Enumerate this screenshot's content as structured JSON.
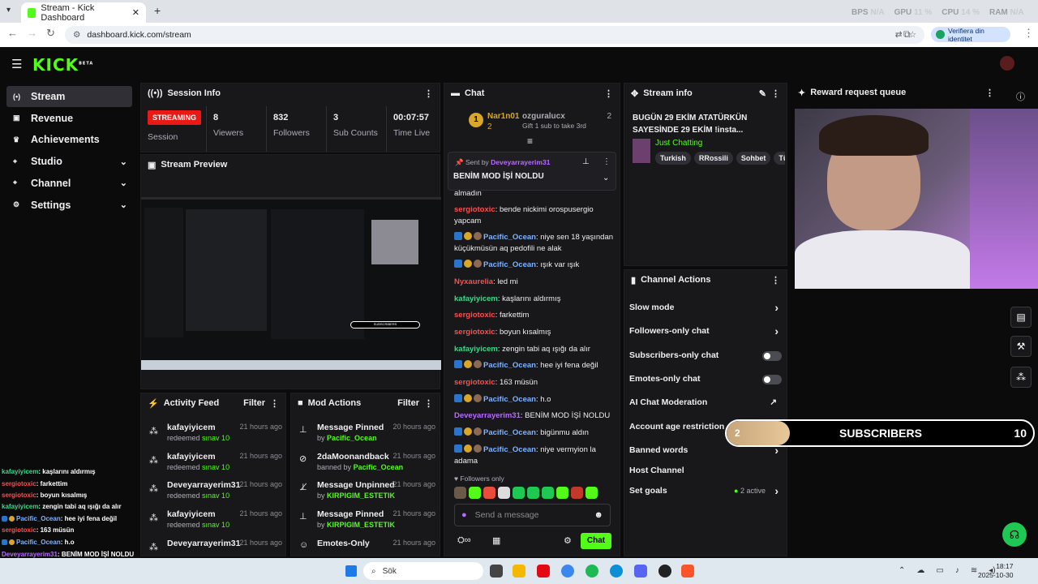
{
  "browser": {
    "tab_title": "Stream - Kick Dashboard",
    "url": "dashboard.kick.com/stream",
    "verify_label": "Verifiera din identitet",
    "hw": [
      {
        "label": "BPS",
        "val": "N/A"
      },
      {
        "label": "GPU",
        "val": "11 %"
      },
      {
        "label": "CPU",
        "val": "14 %"
      },
      {
        "label": "RAM",
        "val": "N/A"
      }
    ]
  },
  "logo": "KICK",
  "logo_beta": "BETA",
  "sidebar": [
    {
      "label": "Stream",
      "icon": "stream-icon",
      "active": true
    },
    {
      "label": "Revenue",
      "icon": "revenue-icon"
    },
    {
      "label": "Achievements",
      "icon": "trophy-icon"
    },
    {
      "label": "Studio",
      "icon": "studio-icon",
      "chev": true
    },
    {
      "label": "Channel",
      "icon": "channel-icon",
      "chev": true
    },
    {
      "label": "Settings",
      "icon": "gear-icon",
      "chev": true
    }
  ],
  "session": {
    "title": "Session Info",
    "status": "STREAMING",
    "status_label": "Session",
    "stats": [
      {
        "n": "8",
        "l": "Viewers"
      },
      {
        "n": "832",
        "l": "Followers"
      },
      {
        "n": "3",
        "l": "Sub Counts"
      },
      {
        "n": "00:07:57",
        "l": "Time Live"
      }
    ]
  },
  "preview": {
    "title": "Stream Preview",
    "subscribers_label": "SUBSCRIBERS"
  },
  "activity": {
    "title": "Activity Feed",
    "filter": "Filter",
    "items": [
      {
        "name": "kafayiyicem",
        "sub": "redeemed",
        "reward": "sınav 10",
        "time": "21 hours ago"
      },
      {
        "name": "kafayiyicem",
        "sub": "redeemed",
        "reward": "sınav 10",
        "time": "21 hours ago"
      },
      {
        "name": "Deveyarrayerim31",
        "sub": "redeemed",
        "reward": "sınav 10",
        "time": "21 hours ago"
      },
      {
        "name": "kafayiyicem",
        "sub": "redeemed",
        "reward": "sınav 10",
        "time": "21 hours ago"
      },
      {
        "name": "Deveyarrayerim31",
        "sub": "",
        "reward": "",
        "time": "21 hours ago"
      }
    ]
  },
  "mod": {
    "title": "Mod Actions",
    "filter": "Filter",
    "items": [
      {
        "name": "Message Pinned",
        "by": "by",
        "who": "Pacific_Ocean",
        "time": "20 hours ago",
        "icon": "pin-icon"
      },
      {
        "name": "2daMoonandback",
        "by": "banned by",
        "who": "Pacific_Ocean",
        "time": "21 hours ago",
        "icon": "ban-icon"
      },
      {
        "name": "Message Unpinned",
        "by": "by",
        "who": "KIRPIGIM_ESTETIK",
        "time": "21 hours ago",
        "icon": "unpin-icon"
      },
      {
        "name": "Message Pinned",
        "by": "by",
        "who": "KIRPIGIM_ESTETIK",
        "time": "21 hours ago",
        "icon": "pin-icon"
      },
      {
        "name": "Emotes-Only",
        "by": "",
        "who": "",
        "time": "21 hours ago",
        "icon": "emote-icon"
      }
    ]
  },
  "chat": {
    "title": "Chat",
    "top": [
      {
        "name": "Nar1n01",
        "n": "2"
      },
      {
        "name": "ozguralucx",
        "n": "2",
        "note": "Gift 1 sub to take 3rd"
      }
    ],
    "pinned": {
      "sent_by": "Sent by",
      "who": "Deveyarrayerim31",
      "msg": "BENİM MOD İŞİ NOLDU"
    },
    "partial_top": "almadın",
    "lines": [
      {
        "u": "sergiotoxic",
        "c": "red",
        "t": "bende nickimi orospusergio yapcam"
      },
      {
        "u": "Pacific_Ocean",
        "c": "blu",
        "b": true,
        "t": "niye sen 18 yaşından küçükmüsün aq pedofili ne alak"
      },
      {
        "u": "Pacific_Ocean",
        "c": "blu",
        "b": true,
        "t": "ışık var ışık"
      },
      {
        "u": "Nyxaurelia",
        "c": "red",
        "t": "led mi"
      },
      {
        "u": "kafayiyicem",
        "c": "grn",
        "t": "kaşlarını aldırmış"
      },
      {
        "u": "sergiotoxic",
        "c": "red",
        "t": "farkettim"
      },
      {
        "u": "sergiotoxic",
        "c": "red",
        "t": "boyun kısalmış"
      },
      {
        "u": "kafayiyicem",
        "c": "grn",
        "t": "zengin tabi aq ışığı da alır"
      },
      {
        "u": "Pacific_Ocean",
        "c": "blu",
        "b": true,
        "t": "hee iyi fena değil"
      },
      {
        "u": "sergiotoxic",
        "c": "red",
        "t": "163 müsün"
      },
      {
        "u": "Pacific_Ocean",
        "c": "blu",
        "b": true,
        "t": "h.o"
      },
      {
        "u": "Deveyarrayerim31",
        "c": "pur",
        "t": "BENİM MOD İŞİ NOLDU"
      },
      {
        "u": "Pacific_Ocean",
        "c": "blu",
        "b": true,
        "t": "bigünmu aldın"
      },
      {
        "u": "Pacific_Ocean",
        "c": "blu",
        "b": true,
        "t": "niye vermyion la adama"
      }
    ],
    "followers_only": "Followers only",
    "placeholder": "Send a message",
    "send": "Chat"
  },
  "stream_info": {
    "title": "Stream info",
    "headline": "BUGÜN 29 EKİM ATATÜRKÜN SAYESİNDE 29 EKİM !insta...",
    "category": "Just Chatting",
    "tags": [
      "Turkish",
      "RRossili",
      "Sohbet",
      "Türk"
    ]
  },
  "actions": {
    "title": "Channel Actions",
    "items": [
      "Slow mode",
      "Followers-only chat",
      "Subscribers-only chat",
      "Emotes-only chat",
      "AI Chat Moderation",
      "Account age restriction",
      "Banned words",
      "Host Channel",
      "Set goals"
    ],
    "goals_active": "2 active"
  },
  "reward": {
    "title": "Reward request queue"
  },
  "sub_bar": {
    "current": "2",
    "label": "SUBSCRIBERS",
    "target": "10",
    "progress": 0.2
  },
  "overlay": [
    {
      "u": "kafayiyicem",
      "c": "#39d98a",
      "t": ": kaşlarını aldırmış"
    },
    {
      "u": "sergiotoxic",
      "c": "#ff4d4d",
      "t": ": farkettim"
    },
    {
      "u": "sergiotoxic",
      "c": "#ff4d4d",
      "t": ": boyun kısalmış"
    },
    {
      "u": "kafayiyicem",
      "c": "#39d98a",
      "t": ": zengin tabi aq ışığı da alır"
    },
    {
      "u": "Pacific_Ocean",
      "c": "#7fb3ff",
      "t": ": hee iyi fena değil"
    },
    {
      "u": "sergiotoxic",
      "c": "#ff4d4d",
      "t": ": 163 müsün"
    },
    {
      "u": "Pacific_Ocean",
      "c": "#7fb3ff",
      "t": ": h.o"
    },
    {
      "u": "Deveyarrayerim31",
      "c": "#b86bff",
      "t": ": BENİM MOD İŞİ NOLDU"
    },
    {
      "u": "Pacific_Ocean",
      "c": "#7fb3ff",
      "t": ": bigünmu aldın"
    },
    {
      "u": "Pacific_Ocean",
      "c": "#7fb3ff",
      "t": ": niye vermyion la adama"
    }
  ],
  "taskbar": {
    "search": "Sök",
    "time": "18:17",
    "date": "2025-10-30"
  }
}
